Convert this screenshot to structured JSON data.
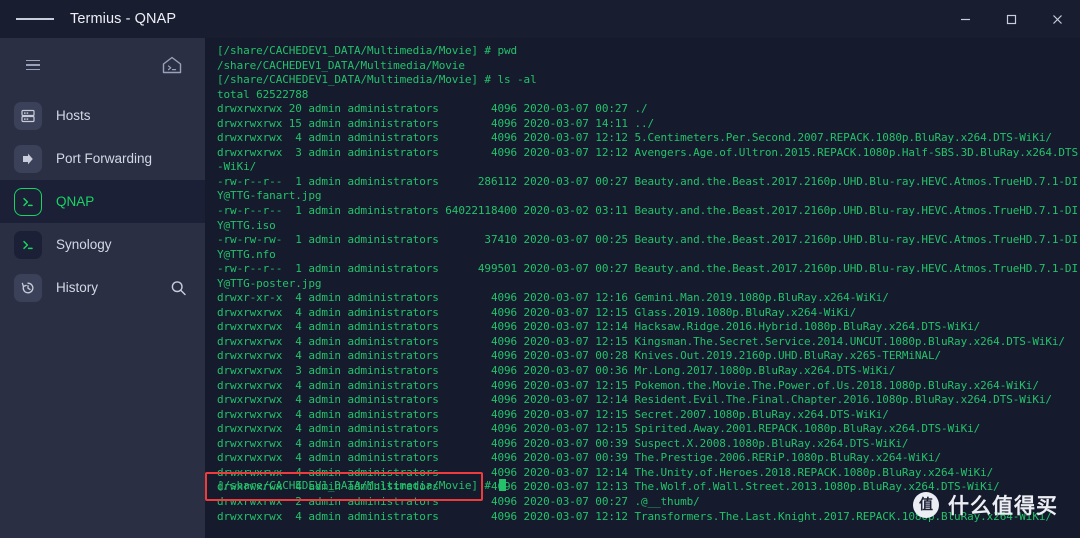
{
  "window": {
    "title": "Termius - QNAP",
    "menu_icon": "hamburger-icon",
    "controls": {
      "minimize": "minimize-icon",
      "maximize": "maximize-icon",
      "close": "close-icon"
    }
  },
  "sidebar": {
    "collapse_icon": "collapse-menu-icon",
    "home_icon": "home-terminal-icon",
    "search_icon": "search-icon",
    "items": [
      {
        "label": "Hosts",
        "icon": "server-icon",
        "selected": false
      },
      {
        "label": "Port Forwarding",
        "icon": "port-forward-icon",
        "selected": false
      },
      {
        "label": "QNAP",
        "icon": "terminal-icon",
        "selected": true
      },
      {
        "label": "Synology",
        "icon": "terminal-icon",
        "selected": false
      },
      {
        "label": "History",
        "icon": "history-clock-icon",
        "selected": false
      }
    ]
  },
  "terminal": {
    "text_color": "#23c26a",
    "background_color": "#151a2d",
    "lines": [
      "[/share/CACHEDEV1_DATA/Multimedia/Movie] # pwd",
      "/share/CACHEDEV1_DATA/Multimedia/Movie",
      "[/share/CACHEDEV1_DATA/Multimedia/Movie] # ls -al",
      "total 62522788",
      "drwxrwxrwx 20 admin administrators        4096 2020-03-07 00:27 ./",
      "drwxrwxrwx 15 admin administrators        4096 2020-03-07 14:11 ../",
      "drwxrwxrwx  4 admin administrators        4096 2020-03-07 12:12 5.Centimeters.Per.Second.2007.REPACK.1080p.BluRay.x264.DTS-WiKi/",
      "drwxrwxrwx  3 admin administrators        4096 2020-03-07 12:12 Avengers.Age.of.Ultron.2015.REPACK.1080p.Half-SBS.3D.BluRay.x264.DTS-WiKi/",
      "-rw-r--r--  1 admin administrators      286112 2020-03-07 00:27 Beauty.and.the.Beast.2017.2160p.UHD.Blu-ray.HEVC.Atmos.TrueHD.7.1-DIY@TTG-fanart.jpg",
      "-rw-r--r--  1 admin administrators 64022118400 2020-03-02 03:11 Beauty.and.the.Beast.2017.2160p.UHD.Blu-ray.HEVC.Atmos.TrueHD.7.1-DIY@TTG.iso",
      "-rw-rw-rw-  1 admin administrators       37410 2020-03-07 00:25 Beauty.and.the.Beast.2017.2160p.UHD.Blu-ray.HEVC.Atmos.TrueHD.7.1-DIY@TTG.nfo",
      "-rw-r--r--  1 admin administrators      499501 2020-03-07 00:27 Beauty.and.the.Beast.2017.2160p.UHD.Blu-ray.HEVC.Atmos.TrueHD.7.1-DIY@TTG-poster.jpg",
      "drwxr-xr-x  4 admin administrators        4096 2020-03-07 12:16 Gemini.Man.2019.1080p.BluRay.x264-WiKi/",
      "drwxrwxrwx  4 admin administrators        4096 2020-03-07 12:15 Glass.2019.1080p.BluRay.x264-WiKi/",
      "drwxrwxrwx  4 admin administrators        4096 2020-03-07 12:14 Hacksaw.Ridge.2016.Hybrid.1080p.BluRay.x264.DTS-WiKi/",
      "drwxrwxrwx  4 admin administrators        4096 2020-03-07 12:15 Kingsman.The.Secret.Service.2014.UNCUT.1080p.BluRay.x264.DTS-WiKi/",
      "drwxrwxrwx  4 admin administrators        4096 2020-03-07 00:28 Knives.Out.2019.2160p.UHD.BluRay.x265-TERMiNAL/",
      "drwxrwxrwx  3 admin administrators        4096 2020-03-07 00:36 Mr.Long.2017.1080p.BluRay.x264.DTS-WiKi/",
      "drwxrwxrwx  4 admin administrators        4096 2020-03-07 12:15 Pokemon.the.Movie.The.Power.of.Us.2018.1080p.BluRay.x264-WiKi/",
      "drwxrwxrwx  4 admin administrators        4096 2020-03-07 12:14 Resident.Evil.The.Final.Chapter.2016.1080p.BluRay.x264.DTS-WiKi/",
      "drwxrwxrwx  4 admin administrators        4096 2020-03-07 12:15 Secret.2007.1080p.BluRay.x264.DTS-WiKi/",
      "drwxrwxrwx  4 admin administrators        4096 2020-03-07 12:15 Spirited.Away.2001.REPACK.1080p.BluRay.x264.DTS-WiKi/",
      "drwxrwxrwx  4 admin administrators        4096 2020-03-07 00:39 Suspect.X.2008.1080p.BluRay.x264.DTS-WiKi/",
      "drwxrwxrwx  4 admin administrators        4096 2020-03-07 00:39 The.Prestige.2006.RERiP.1080p.BluRay.x264-WiKi/",
      "drwxrwxrwx  4 admin administrators        4096 2020-03-07 12:14 The.Unity.of.Heroes.2018.REPACK.1080p.BluRay.x264-WiKi/",
      "drwxrwxrwx  4 admin administrators        4096 2020-03-07 12:13 The.Wolf.of.Wall.Street.2013.1080p.BluRay.x264.DTS-WiKi/",
      "drwxrwxrwx  2 admin administrators        4096 2020-03-07 00:27 .@__thumb/",
      "drwxrwxrwx  4 admin administrators        4096 2020-03-07 12:12 Transformers.The.Last.Knight.2017.REPACK.1080p.BluRay.x264-WiKi/"
    ],
    "prompt": "[/share/CACHEDEV1_DATA/Multimedia/Movie] # ",
    "highlight_color": "#ef3b3b"
  },
  "watermark": {
    "badge": "值",
    "text": "什么值得买"
  }
}
